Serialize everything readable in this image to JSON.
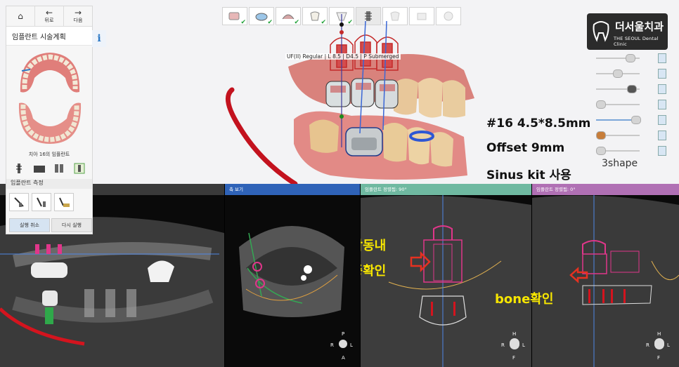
{
  "nav": {
    "home_icon": "home-icon",
    "back_label": "뒤로",
    "forward_label": "다음"
  },
  "panel": {
    "title": "임플란트 시술계획",
    "info": "i",
    "caption": "치아 16의 임플란트",
    "measure_title": "임플란트 측정",
    "undo_label": "실행 취소",
    "redo_label": "다시 실행"
  },
  "workflow": {
    "steps": [
      "step-1",
      "step-2",
      "step-3",
      "step-4",
      "step-5",
      "step-6",
      "step-7",
      "step-8",
      "step-9"
    ],
    "current_index": 5
  },
  "logo": {
    "korean": "더서울치과",
    "english": "THE SEOUL Dental Clinic"
  },
  "implant_label": "UF(II) Regular | L 8.5 | D4.5 | P Submerged",
  "annotations": [
    "#16 4.5*8.5mm",
    "Offset 9mm",
    "Sinus kit 사용"
  ],
  "brand": "3shape",
  "views": [
    {
      "title": "",
      "color": "#3a3a3a"
    },
    {
      "title": "축 보기",
      "color": "#2f63b8"
    },
    {
      "title": "임플란트 정렬됨: 90°",
      "color": "#6fb9a1"
    },
    {
      "title": "임플란트 정렬됨: 0°",
      "color": "#b070b4"
    }
  ],
  "orientation": {
    "axial": [
      "P",
      "R",
      "L",
      "A"
    ],
    "cross90": [
      "H",
      "R",
      "L",
      "F"
    ],
    "cross0": [
      "H",
      "R",
      "L",
      "F"
    ]
  },
  "overlays": {
    "sinus_line1": "상악동내",
    "sinus_line2": "염증확인",
    "bone": "bone확인"
  },
  "colors": {
    "accent": "#2b78c5",
    "annotation_yellow": "#f7e600",
    "implant_pink": "#e0368a"
  }
}
